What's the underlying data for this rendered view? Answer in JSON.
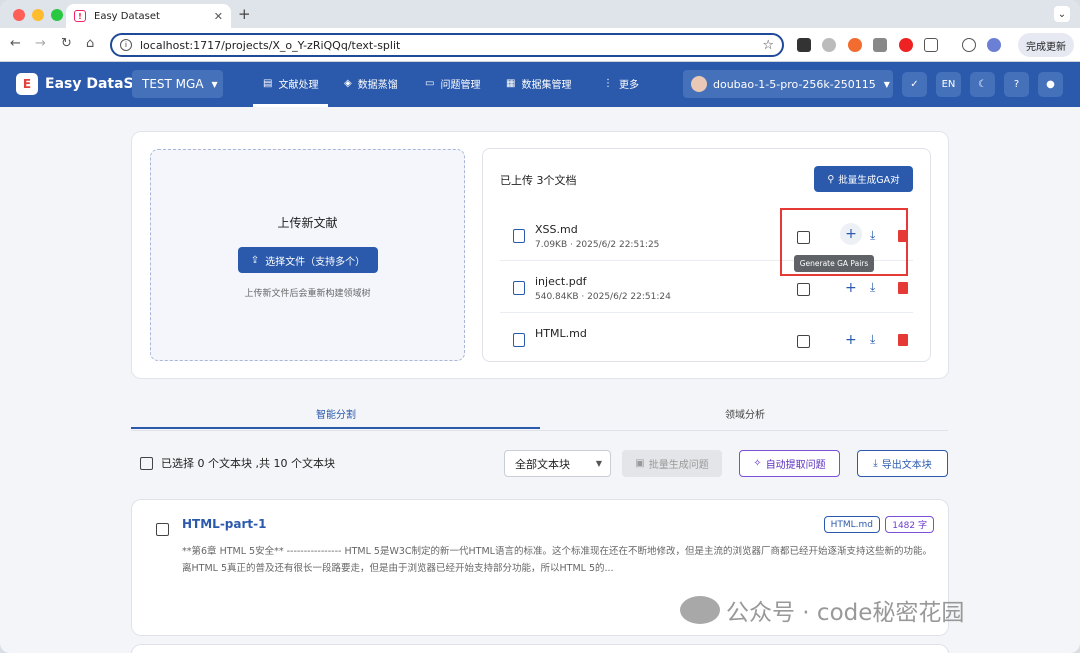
{
  "browser": {
    "tab_title": "Easy Dataset",
    "tab_favicon": "!",
    "url": "localhost:1717/projects/X_o_Y-zRiQQq/text-split",
    "update_label": "完成更新"
  },
  "app": {
    "logo": "E",
    "brand": "Easy DataSet",
    "project": "TEST MGA",
    "menu": [
      {
        "label": "文献处理",
        "icon": "document-icon",
        "active": true
      },
      {
        "label": "数据蒸馏",
        "icon": "cube-icon"
      },
      {
        "label": "问题管理",
        "icon": "chat-icon"
      },
      {
        "label": "数据集管理",
        "icon": "grid-icon"
      },
      {
        "label": "更多",
        "icon": "more-icon"
      }
    ],
    "model": "doubao-1-5-pro-256k-250115",
    "lang": "EN"
  },
  "upload": {
    "title": "上传新文献",
    "button": "选择文件（支持多个）",
    "hint": "上传新文件后会重新构建领域树"
  },
  "docs": {
    "title": "已上传 3个文档",
    "batch_button": "批量生成GA对",
    "items": [
      {
        "name": "XSS.md",
        "meta": "7.09KB · 2025/6/2 22:51:25"
      },
      {
        "name": "inject.pdf",
        "meta": "540.84KB · 2025/6/2 22:51:24"
      },
      {
        "name": "HTML.md",
        "meta": ""
      }
    ],
    "tooltip": "Generate GA Pairs"
  },
  "tabs": [
    "智能分割",
    "领域分析"
  ],
  "toolbar": {
    "selected_text": "已选择 0 个文本块 ,共 10 个文本块",
    "filter": "全部文本块",
    "batch_questions": "批量生成问题",
    "auto_extract": "自动提取问题",
    "export": "导出文本块"
  },
  "chunk": {
    "title": "HTML-part-1",
    "file_tag": "HTML.md",
    "chars_tag": "1482 字",
    "text": "**第6章 HTML 5安全** ---------------- HTML 5是W3C制定的新一代HTML语言的标准。这个标准现在还在不断地修改，但是主流的浏览器厂商都已经开始逐渐支持这些新的功能。离HTML 5真正的普及还有很长一段路要走，但是由于浏览器已经开始支持部分功能，所以HTML 5的..."
  },
  "watermark": "公众号 · code秘密花园",
  "colors": {
    "primary": "#2b5aad",
    "danger": "#e53935",
    "purple": "#7b4fd6"
  }
}
